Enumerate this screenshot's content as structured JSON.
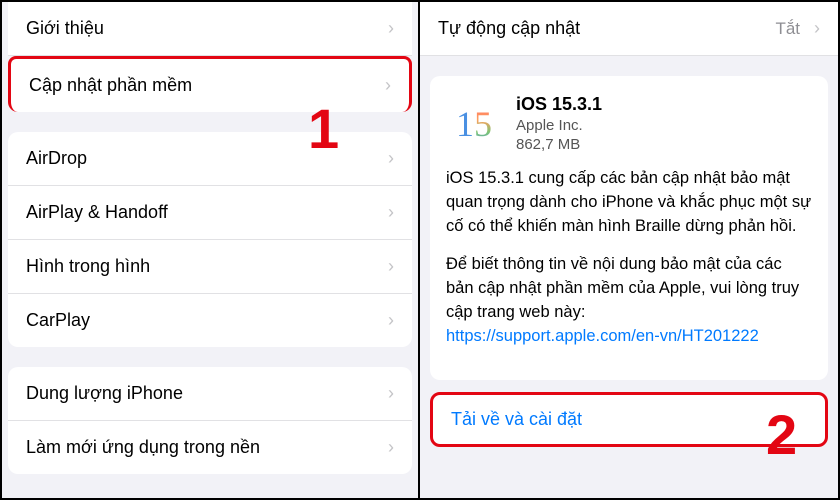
{
  "left": {
    "top": [
      {
        "label": "Giới thiệu"
      },
      {
        "label": "Cập nhật phần mềm",
        "highlight": true
      }
    ],
    "group1": [
      {
        "label": "AirDrop"
      },
      {
        "label": "AirPlay & Handoff"
      },
      {
        "label": "Hình trong hình"
      },
      {
        "label": "CarPlay"
      }
    ],
    "group2": [
      {
        "label": "Dung lượng iPhone"
      },
      {
        "label": "Làm mới ứng dụng trong nền"
      }
    ]
  },
  "right": {
    "auto_update_label": "Tự động cập nhật",
    "auto_update_value": "Tắt",
    "update": {
      "icon_text": "15",
      "title": "iOS 15.3.1",
      "vendor": "Apple Inc.",
      "size": "862,7 MB",
      "desc1": "iOS 15.3.1 cung cấp các bản cập nhật bảo mật quan trọng dành cho iPhone và khắc phục một sự cố có thể khiến màn hình Braille dừng phản hồi.",
      "desc2_prefix": "Để biết thông tin về nội dung bảo mật của các bản cập nhật phần mềm của Apple, vui lòng truy cập trang web này:",
      "desc2_link": "https://support.apple.com/en-vn/HT201222"
    },
    "install_label": "Tải về và cài đặt"
  },
  "annotations": {
    "num1": "1",
    "num2": "2"
  }
}
